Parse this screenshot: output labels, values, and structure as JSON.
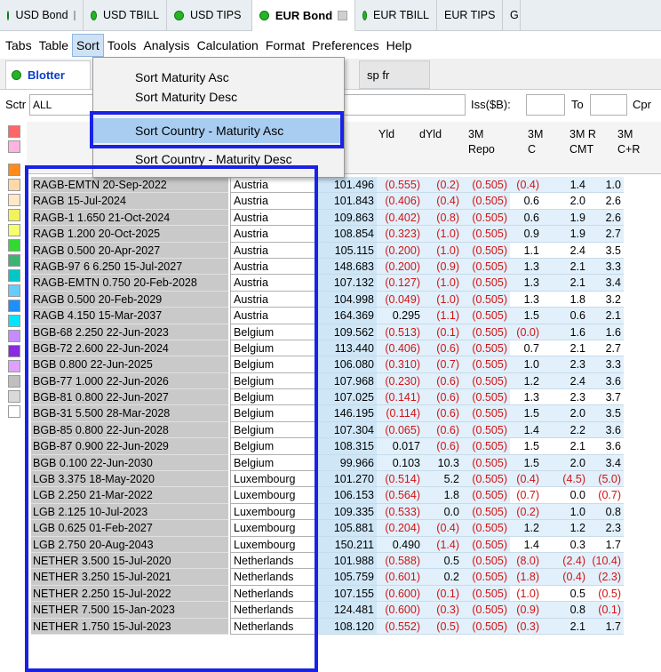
{
  "top_tabs": [
    {
      "label": "USD Bond",
      "dot": true,
      "close": true,
      "active": false
    },
    {
      "label": "USD TBILL",
      "dot": true,
      "close": false,
      "active": false
    },
    {
      "label": "USD TIPS",
      "dot": true,
      "close": false,
      "active": false
    },
    {
      "label": "EUR Bond",
      "dot": true,
      "close": true,
      "active": true
    },
    {
      "label": "EUR TBILL",
      "dot": true,
      "close": false,
      "active": false
    },
    {
      "label": "EUR TIPS",
      "dot": false,
      "close": false,
      "active": false
    },
    {
      "label": "G",
      "dot": false,
      "close": false,
      "active": false
    }
  ],
  "menu": [
    "Tabs",
    "Table",
    "Sort",
    "Tools",
    "Analysis",
    "Calculation",
    "Format",
    "Preferences",
    "Help"
  ],
  "sort_menu": [
    "Sort Maturity Asc",
    "Sort Maturity Desc",
    "Sort Country - Maturity Asc",
    "Sort Country - Maturity Desc"
  ],
  "sub_tabs": {
    "blotter": "Blotter",
    "spfr": "sp fr"
  },
  "filter": {
    "sctr_label": "Sctr",
    "sctr_value": "ALL",
    "iss_label": "Iss($B):",
    "to_label": "To",
    "cpr_label": "Cpr"
  },
  "columns": [
    "Yld",
    "dYld",
    "3M\nRepo",
    "3M\nC",
    "3M R\nCMT",
    "3M\nC+R"
  ],
  "swatch_colors": [
    "#ff6666",
    "#ffb3e0",
    "#ff8c1a",
    "#ffd9a8",
    "#ffe7c7",
    "#f2f25a",
    "#f5ff6e",
    "#33d933",
    "#3cb371",
    "#00c8c8",
    "#66ccff",
    "#1f8fff",
    "#00e5ff",
    "#c58cff",
    "#8a2be2",
    "#e0a0ff",
    "#bfbfbf",
    "#d9d9d9",
    "#ffffff"
  ],
  "rows": [
    [
      "RAGB-EMTN 20-Sep-2022",
      "Austria",
      "101.496",
      "(0.555)",
      "(0.2)",
      "(0.505)",
      "(0.4)",
      "1.4",
      "1.0"
    ],
    [
      "RAGB 15-Jul-2024",
      "Austria",
      "101.843",
      "(0.406)",
      "(0.4)",
      "(0.505)",
      "0.6",
      "2.0",
      "2.6"
    ],
    [
      "RAGB-1 1.650 21-Oct-2024",
      "Austria",
      "109.863",
      "(0.402)",
      "(0.8)",
      "(0.505)",
      "0.6",
      "1.9",
      "2.6"
    ],
    [
      "RAGB 1.200 20-Oct-2025",
      "Austria",
      "108.854",
      "(0.323)",
      "(1.0)",
      "(0.505)",
      "0.9",
      "1.9",
      "2.7"
    ],
    [
      "RAGB 0.500 20-Apr-2027",
      "Austria",
      "105.115",
      "(0.200)",
      "(1.0)",
      "(0.505)",
      "1.1",
      "2.4",
      "3.5"
    ],
    [
      "RAGB-97 6 6.250 15-Jul-2027",
      "Austria",
      "148.683",
      "(0.200)",
      "(0.9)",
      "(0.505)",
      "1.3",
      "2.1",
      "3.3"
    ],
    [
      "RAGB-EMTN 0.750 20-Feb-2028",
      "Austria",
      "107.132",
      "(0.127)",
      "(1.0)",
      "(0.505)",
      "1.3",
      "2.1",
      "3.4"
    ],
    [
      "RAGB 0.500 20-Feb-2029",
      "Austria",
      "104.998",
      "(0.049)",
      "(1.0)",
      "(0.505)",
      "1.3",
      "1.8",
      "3.2"
    ],
    [
      "RAGB 4.150 15-Mar-2037",
      "Austria",
      "164.369",
      "0.295",
      "(1.1)",
      "(0.505)",
      "1.5",
      "0.6",
      "2.1"
    ],
    [
      "BGB-68 2.250 22-Jun-2023",
      "Belgium",
      "109.562",
      "(0.513)",
      "(0.1)",
      "(0.505)",
      "(0.0)",
      "1.6",
      "1.6"
    ],
    [
      "BGB-72 2.600 22-Jun-2024",
      "Belgium",
      "113.440",
      "(0.406)",
      "(0.6)",
      "(0.505)",
      "0.7",
      "2.1",
      "2.7"
    ],
    [
      "BGB 0.800 22-Jun-2025",
      "Belgium",
      "106.080",
      "(0.310)",
      "(0.7)",
      "(0.505)",
      "1.0",
      "2.3",
      "3.3"
    ],
    [
      "BGB-77 1.000 22-Jun-2026",
      "Belgium",
      "107.968",
      "(0.230)",
      "(0.6)",
      "(0.505)",
      "1.2",
      "2.4",
      "3.6"
    ],
    [
      "BGB-81 0.800 22-Jun-2027",
      "Belgium",
      "107.025",
      "(0.141)",
      "(0.6)",
      "(0.505)",
      "1.3",
      "2.3",
      "3.7"
    ],
    [
      "BGB-31 5.500 28-Mar-2028",
      "Belgium",
      "146.195",
      "(0.114)",
      "(0.6)",
      "(0.505)",
      "1.5",
      "2.0",
      "3.5"
    ],
    [
      "BGB-85 0.800 22-Jun-2028",
      "Belgium",
      "107.304",
      "(0.065)",
      "(0.6)",
      "(0.505)",
      "1.4",
      "2.2",
      "3.6"
    ],
    [
      "BGB-87 0.900 22-Jun-2029",
      "Belgium",
      "108.315",
      "0.017",
      "(0.6)",
      "(0.505)",
      "1.5",
      "2.1",
      "3.6"
    ],
    [
      "BGB 0.100 22-Jun-2030",
      "Belgium",
      "99.966",
      "0.103",
      "10.3",
      "(0.505)",
      "1.5",
      "2.0",
      "3.4"
    ],
    [
      "LGB 3.375 18-May-2020",
      "Luxembourg",
      "101.270",
      "(0.514)",
      "5.2",
      "(0.505)",
      "(0.4)",
      "(4.5)",
      "(5.0)"
    ],
    [
      "LGB 2.250 21-Mar-2022",
      "Luxembourg",
      "106.153",
      "(0.564)",
      "1.8",
      "(0.505)",
      "(0.7)",
      "0.0",
      "(0.7)"
    ],
    [
      "LGB 2.125 10-Jul-2023",
      "Luxembourg",
      "109.335",
      "(0.533)",
      "0.0",
      "(0.505)",
      "(0.2)",
      "1.0",
      "0.8"
    ],
    [
      "LGB 0.625 01-Feb-2027",
      "Luxembourg",
      "105.881",
      "(0.204)",
      "(0.4)",
      "(0.505)",
      "1.2",
      "1.2",
      "2.3"
    ],
    [
      "LGB 2.750 20-Aug-2043",
      "Luxembourg",
      "150.211",
      "0.490",
      "(1.4)",
      "(0.505)",
      "1.4",
      "0.3",
      "1.7"
    ],
    [
      "NETHER 3.500 15-Jul-2020",
      "Netherlands",
      "101.988",
      "(0.588)",
      "0.5",
      "(0.505)",
      "(8.0)",
      "(2.4)",
      "(10.4)"
    ],
    [
      "NETHER 3.250 15-Jul-2021",
      "Netherlands",
      "105.759",
      "(0.601)",
      "0.2",
      "(0.505)",
      "(1.8)",
      "(0.4)",
      "(2.3)"
    ],
    [
      "NETHER 2.250 15-Jul-2022",
      "Netherlands",
      "107.155",
      "(0.600)",
      "(0.1)",
      "(0.505)",
      "(1.0)",
      "0.5",
      "(0.5)"
    ],
    [
      "NETHER 7.500 15-Jan-2023",
      "Netherlands",
      "124.481",
      "(0.600)",
      "(0.3)",
      "(0.505)",
      "(0.9)",
      "0.8",
      "(0.1)"
    ],
    [
      "NETHER 1.750 15-Jul-2023",
      "Netherlands",
      "108.120",
      "(0.552)",
      "(0.5)",
      "(0.505)",
      "(0.3)",
      "2.1",
      "1.7"
    ]
  ]
}
